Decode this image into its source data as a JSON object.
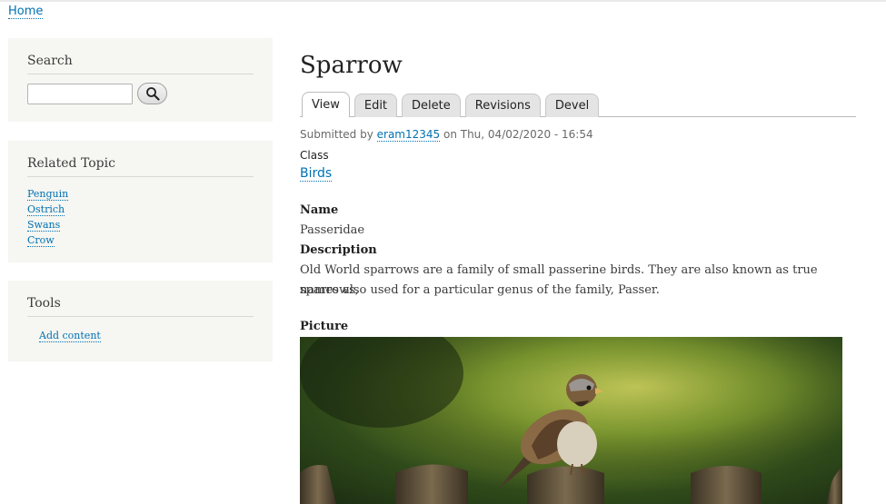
{
  "breadcrumb": {
    "home": "Home"
  },
  "sidebar": {
    "search": {
      "title": "Search",
      "placeholder": ""
    },
    "related": {
      "title": "Related Topic",
      "items": [
        "Penguin",
        "Ostrich",
        "Swans",
        "Crow"
      ]
    },
    "tools": {
      "title": "Tools",
      "add_content": "Add content"
    }
  },
  "node": {
    "title": "Sparrow",
    "tabs": [
      "View",
      "Edit",
      "Delete",
      "Revisions",
      "Devel"
    ],
    "submitted": {
      "prefix": "Submitted by ",
      "author": "eram12345",
      "date": " on Thu, 04/02/2020 - 16:54"
    },
    "class_label": "Class",
    "class_value": "Birds",
    "name_label": "Name",
    "name_value": "Passeridae",
    "description_label": "Description",
    "description_line1": "Old World sparrows are a family of small passerine birds. They are also known as true sparrows,",
    "description_line2": "names also used for a particular genus of the family, Passer.",
    "picture_label": "Picture"
  },
  "colors": {
    "link": "#0071b3",
    "sidebar_bg": "#f6f6f2"
  }
}
